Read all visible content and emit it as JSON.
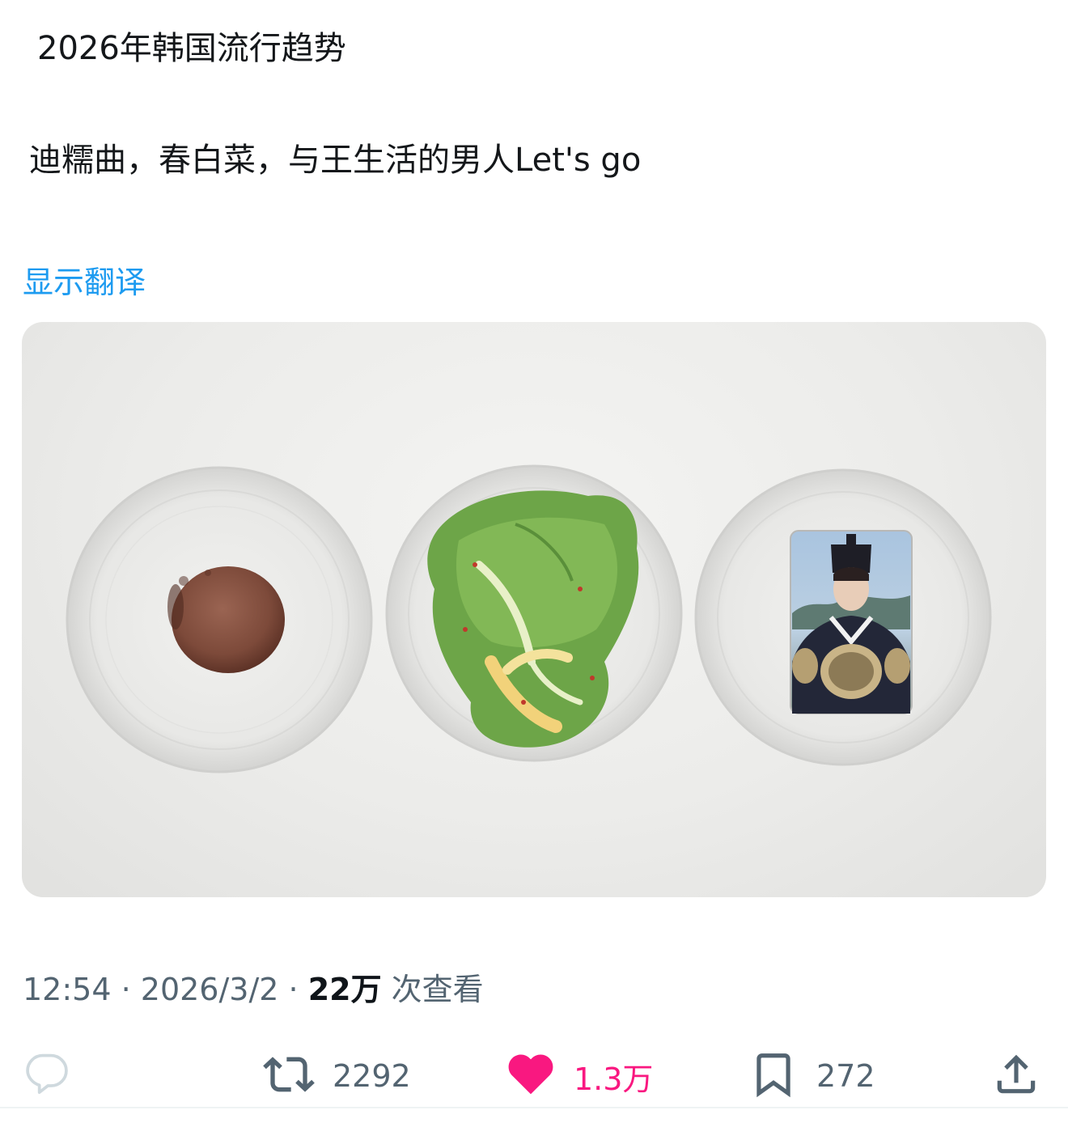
{
  "post": {
    "title_line": "2026年韩国流行趋势",
    "body_line": "迪糯曲，春白菜，与王生活的男人Let's go",
    "translate_link": "显示翻译"
  },
  "meta": {
    "time": "12:54",
    "separator": " · ",
    "date": "2026/3/2",
    "views_count": "22万",
    "views_label": " 次查看"
  },
  "actions": {
    "reply": {
      "icon": "reply-icon",
      "count": ""
    },
    "retweet": {
      "icon": "retweet-icon",
      "count": "2292"
    },
    "like": {
      "icon": "heart-icon",
      "count": "1.3万",
      "color": "#f91880",
      "liked": true
    },
    "bookmark": {
      "icon": "bookmark-icon",
      "count": "272"
    },
    "share": {
      "icon": "share-icon"
    }
  },
  "colors": {
    "link": "#1d9bf0",
    "meta_text": "#536471",
    "like": "#f91880"
  }
}
